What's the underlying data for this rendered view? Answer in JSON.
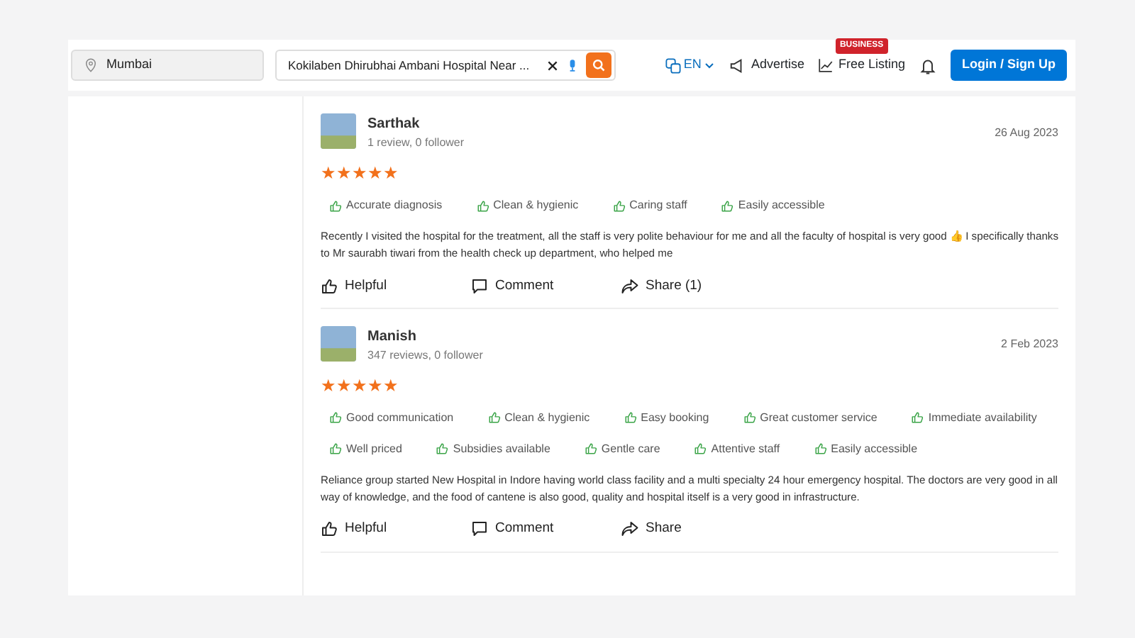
{
  "header": {
    "location": "Mumbai",
    "search": "Kokilaben Dhirubhai Ambani Hospital Near ...",
    "language": "EN",
    "advertise": "Advertise",
    "free_listing": "Free Listing",
    "business_badge": "BUSINESS",
    "login": "Login / Sign Up"
  },
  "reviews": [
    {
      "name": "Sarthak",
      "meta": "1 review, 0 follower",
      "date": "26 Aug 2023",
      "stars": 5,
      "tags": [
        "Accurate diagnosis",
        "Clean & hygienic",
        "Caring staff",
        "Easily accessible"
      ],
      "text": "Recently I visited the hospital for the treatment, all the staff is very polite behaviour for me and all the faculty of hospital is very good 👍 I specifically thanks to Mr saurabh tiwari from the health check up department, who helped me",
      "actions": [
        "Helpful",
        "Comment",
        "Share (1)"
      ]
    },
    {
      "name": "Manish",
      "meta": "347 reviews, 0 follower",
      "date": "2 Feb 2023",
      "stars": 5,
      "tags": [
        "Good communication",
        "Clean & hygienic",
        "Easy booking",
        "Great customer service",
        "Immediate availability",
        "Well priced",
        "Subsidies available",
        "Gentle care",
        "Attentive staff",
        "Easily accessible"
      ],
      "text": "Reliance group started New Hospital in Indore having world class facility and a multi specialty 24 hour emergency hospital. The doctors are very good in all way of knowledge, and the food of cantene is also good, quality and hospital itself is a very good in infrastructure.",
      "actions": [
        "Helpful",
        "Comment",
        "Share"
      ]
    }
  ]
}
